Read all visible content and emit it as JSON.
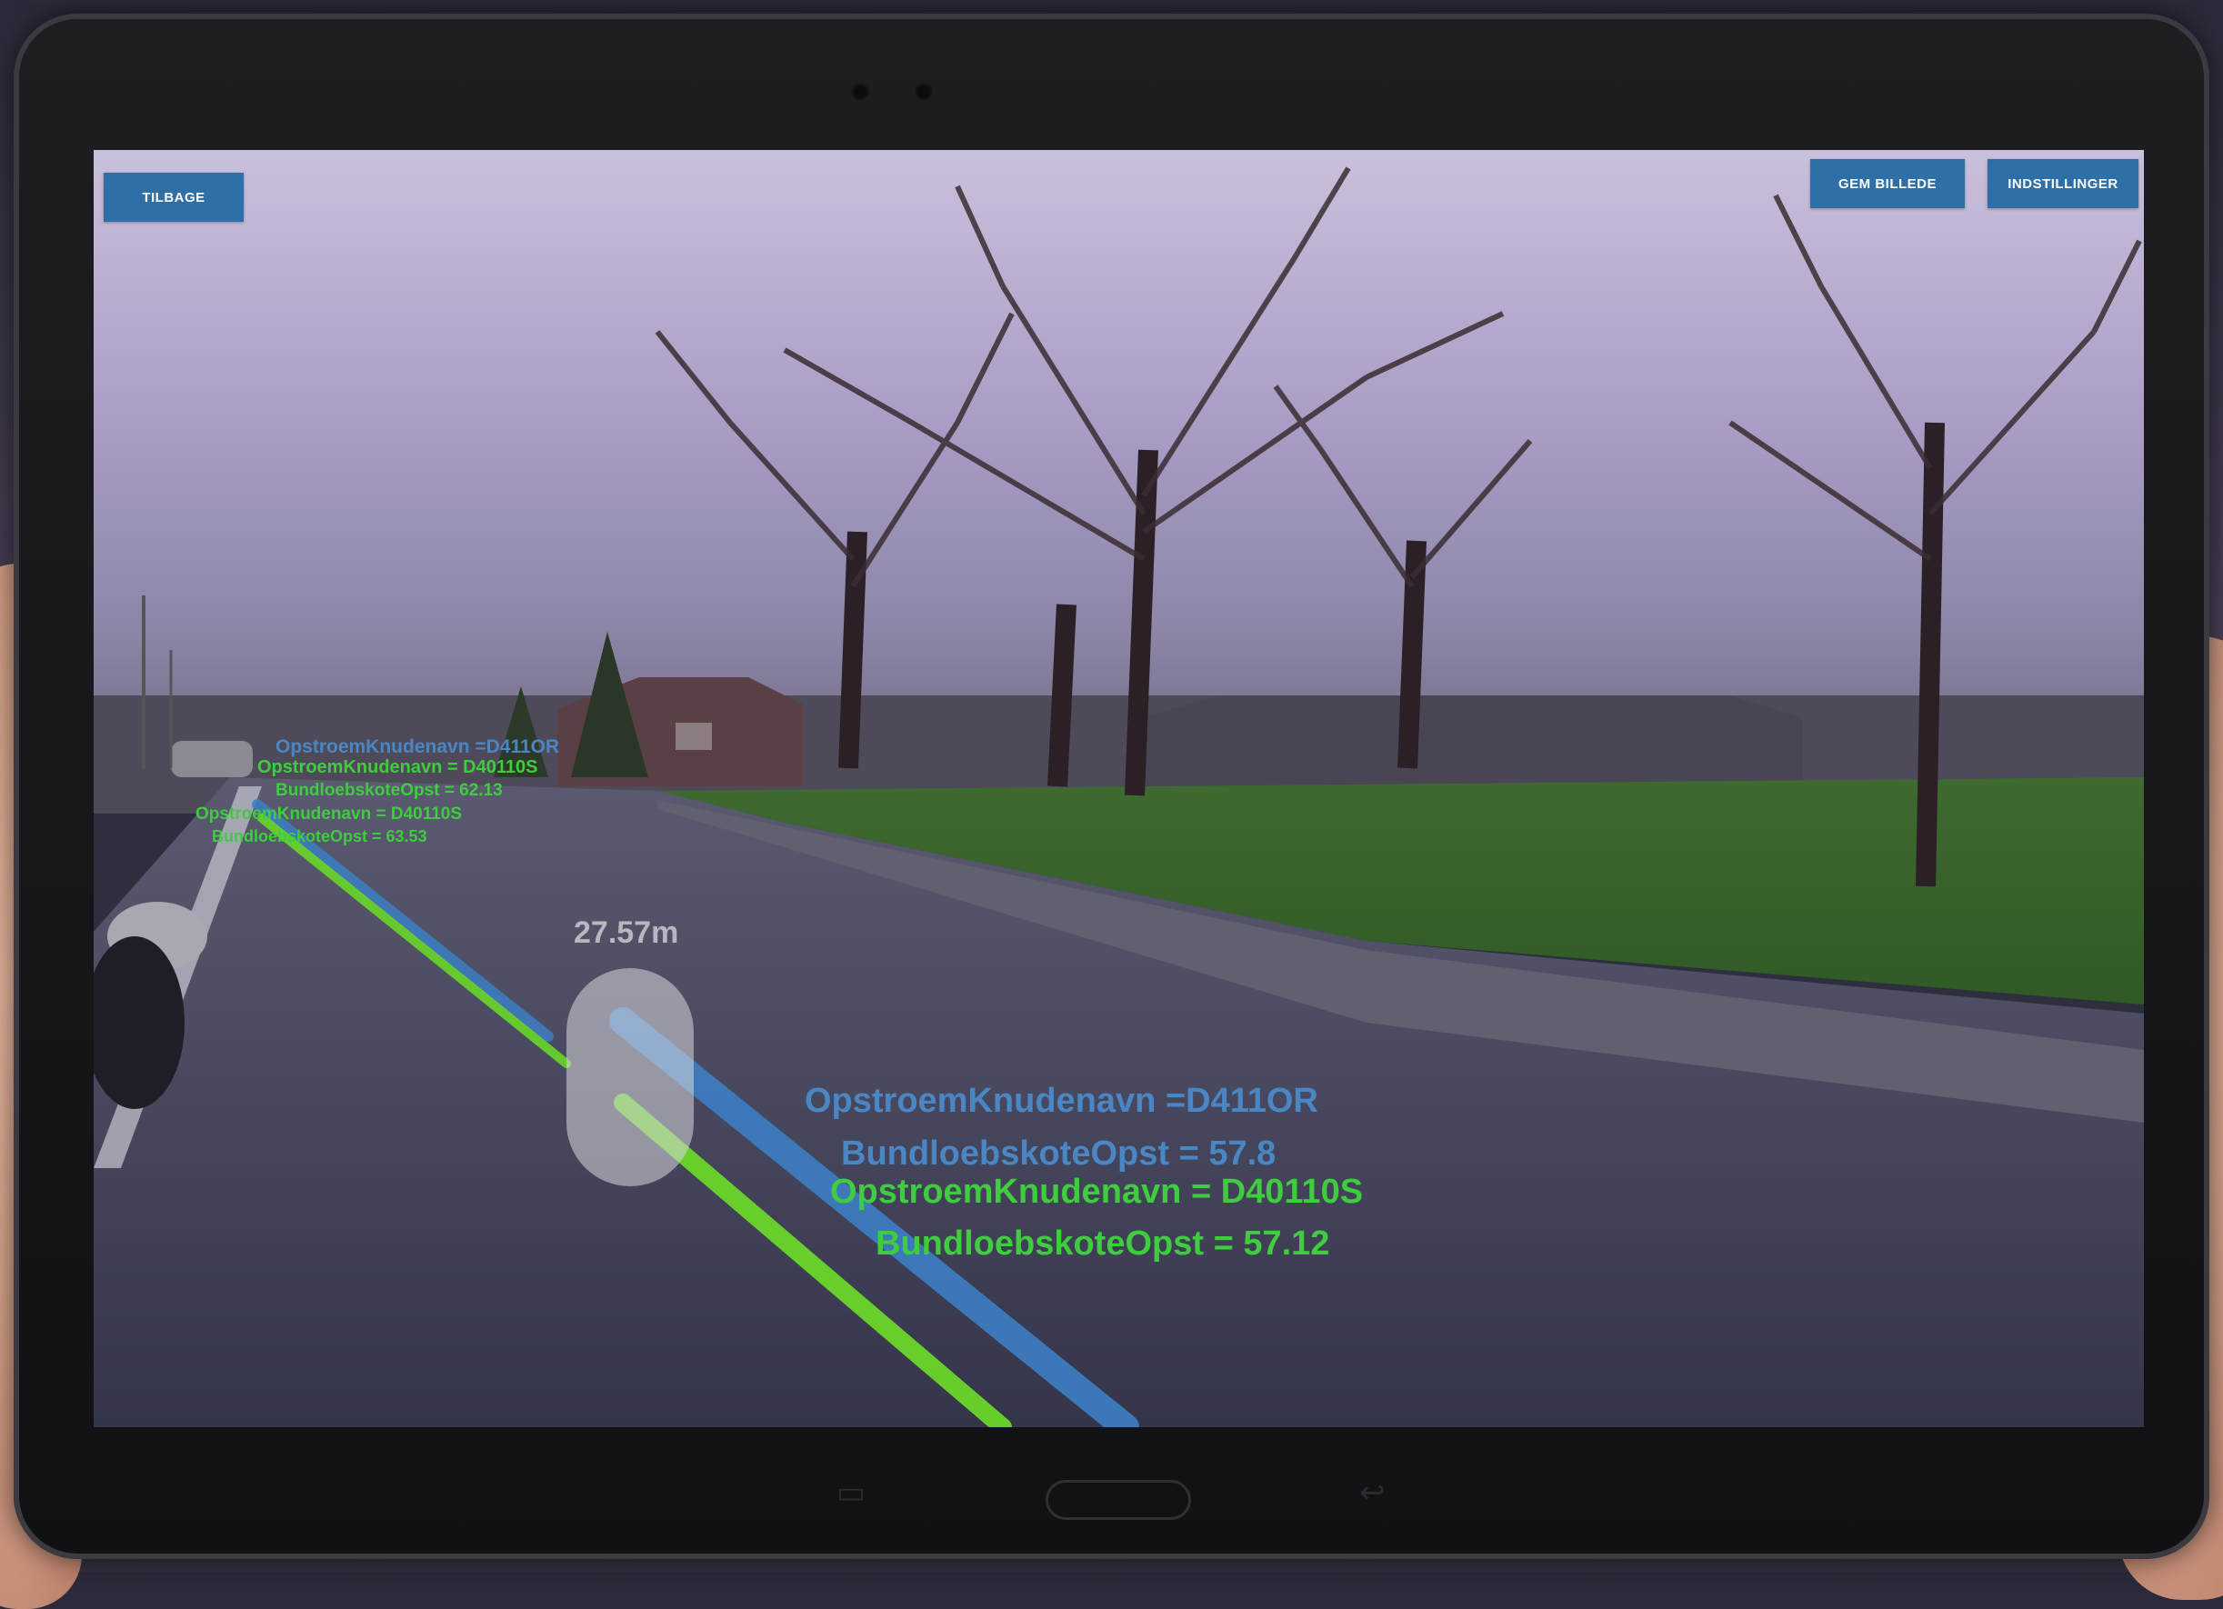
{
  "toolbar": {
    "back_label": "TILBAGE",
    "save_image_label": "GEM BILLEDE",
    "settings_label": "INDSTILLINGER"
  },
  "ar_overlay": {
    "distance": "27.57m",
    "near_labels": {
      "blue_node": "OpstroemKnudenavn =D411OR",
      "blue_elevation": "BundloebskoteOpst = 57.8",
      "green_node": "OpstroemKnudenavn = D40110S",
      "green_elevation": "BundloebskoteOpst = 57.12"
    },
    "far_labels": {
      "blue_node": "OpstroemKnudenavn =D411OR",
      "green_node": "OpstroemKnudenavn = D40110S",
      "blue_elevation": "BundloebskoteOpst = 62.13",
      "green_node_2": "OpstroemKnudenavn = D40110S",
      "green_elevation": "BundloebskoteOpst = 63.53"
    },
    "colors": {
      "blue_pipe": "#3d7fc4",
      "green_pipe": "#6ad62a"
    }
  }
}
